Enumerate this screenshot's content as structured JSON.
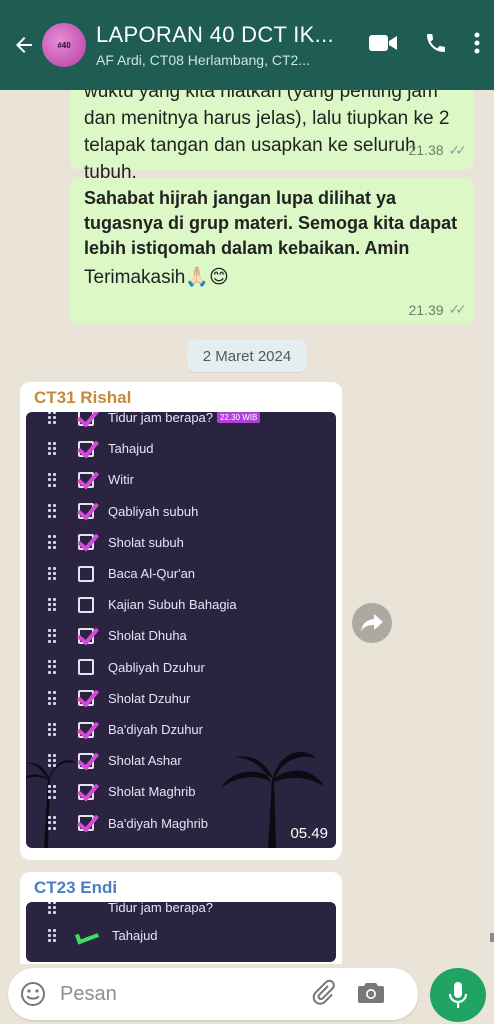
{
  "header": {
    "title": "LAPORAN 40 DCT IK...",
    "subtitle": "AF Ardi, CT08 Herlambang, CT2...",
    "avatar_text": "#40"
  },
  "messages": {
    "m1": {
      "text": "wuktu yang kita niatkan (yang penting jam dan menitnya harus jelas), lalu tiupkan ke 2 telapak tangan dan usapkan ke seluruh tubuh.",
      "time": "21.38"
    },
    "m2": {
      "bold_text": "Sahabat hijrah jangan lupa dilihat ya tugasnya di grup materi. Semoga kita dapat lebih istiqomah dalam kebaikan. Amin",
      "thanks": "Terimakasih🙏🏻😊",
      "time": "21.39"
    },
    "date_divider": "2 Maret 2024",
    "m3": {
      "sender": "CT31 Rishal",
      "sender_color": "#c5893a",
      "time": "05.49",
      "image_rows": [
        {
          "label": "Tidur jam berapa?",
          "checked": true,
          "tag": "22.30 WIB"
        },
        {
          "label": "Tahajud",
          "checked": true
        },
        {
          "label": "Witir",
          "checked": true
        },
        {
          "label": "Qabliyah subuh",
          "checked": true
        },
        {
          "label": "Sholat subuh",
          "checked": true
        },
        {
          "label": "Baca Al-Qur'an",
          "checked": false
        },
        {
          "label": "Kajian Subuh Bahagia",
          "checked": false
        },
        {
          "label": "Sholat Dhuha",
          "checked": true
        },
        {
          "label": "Qabliyah Dzuhur",
          "checked": false
        },
        {
          "label": "Sholat Dzuhur",
          "checked": true
        },
        {
          "label": "Ba'diyah Dzuhur",
          "checked": true
        },
        {
          "label": "Sholat Ashar",
          "checked": true
        },
        {
          "label": "Sholat Maghrib",
          "checked": true
        },
        {
          "label": "Ba'diyah Maghrib",
          "checked": true
        }
      ]
    },
    "m4": {
      "sender": "CT23 Endi",
      "sender_color": "#4a7fc1",
      "image_rows": [
        {
          "label": "Tidur jam berapa?"
        },
        {
          "label": "Tahajud"
        }
      ]
    }
  },
  "composer": {
    "placeholder": "Pesan"
  },
  "icons": [
    "back-arrow-icon",
    "video-call-icon",
    "phone-icon",
    "more-vert-icon",
    "forward-icon",
    "scroll-down-icon",
    "emoji-icon",
    "attach-icon",
    "camera-icon",
    "mic-icon"
  ],
  "colors": {
    "header_bg": "#1f5c54",
    "outgoing_bubble": "#dcf8c6",
    "mic_button": "#1fa463"
  }
}
